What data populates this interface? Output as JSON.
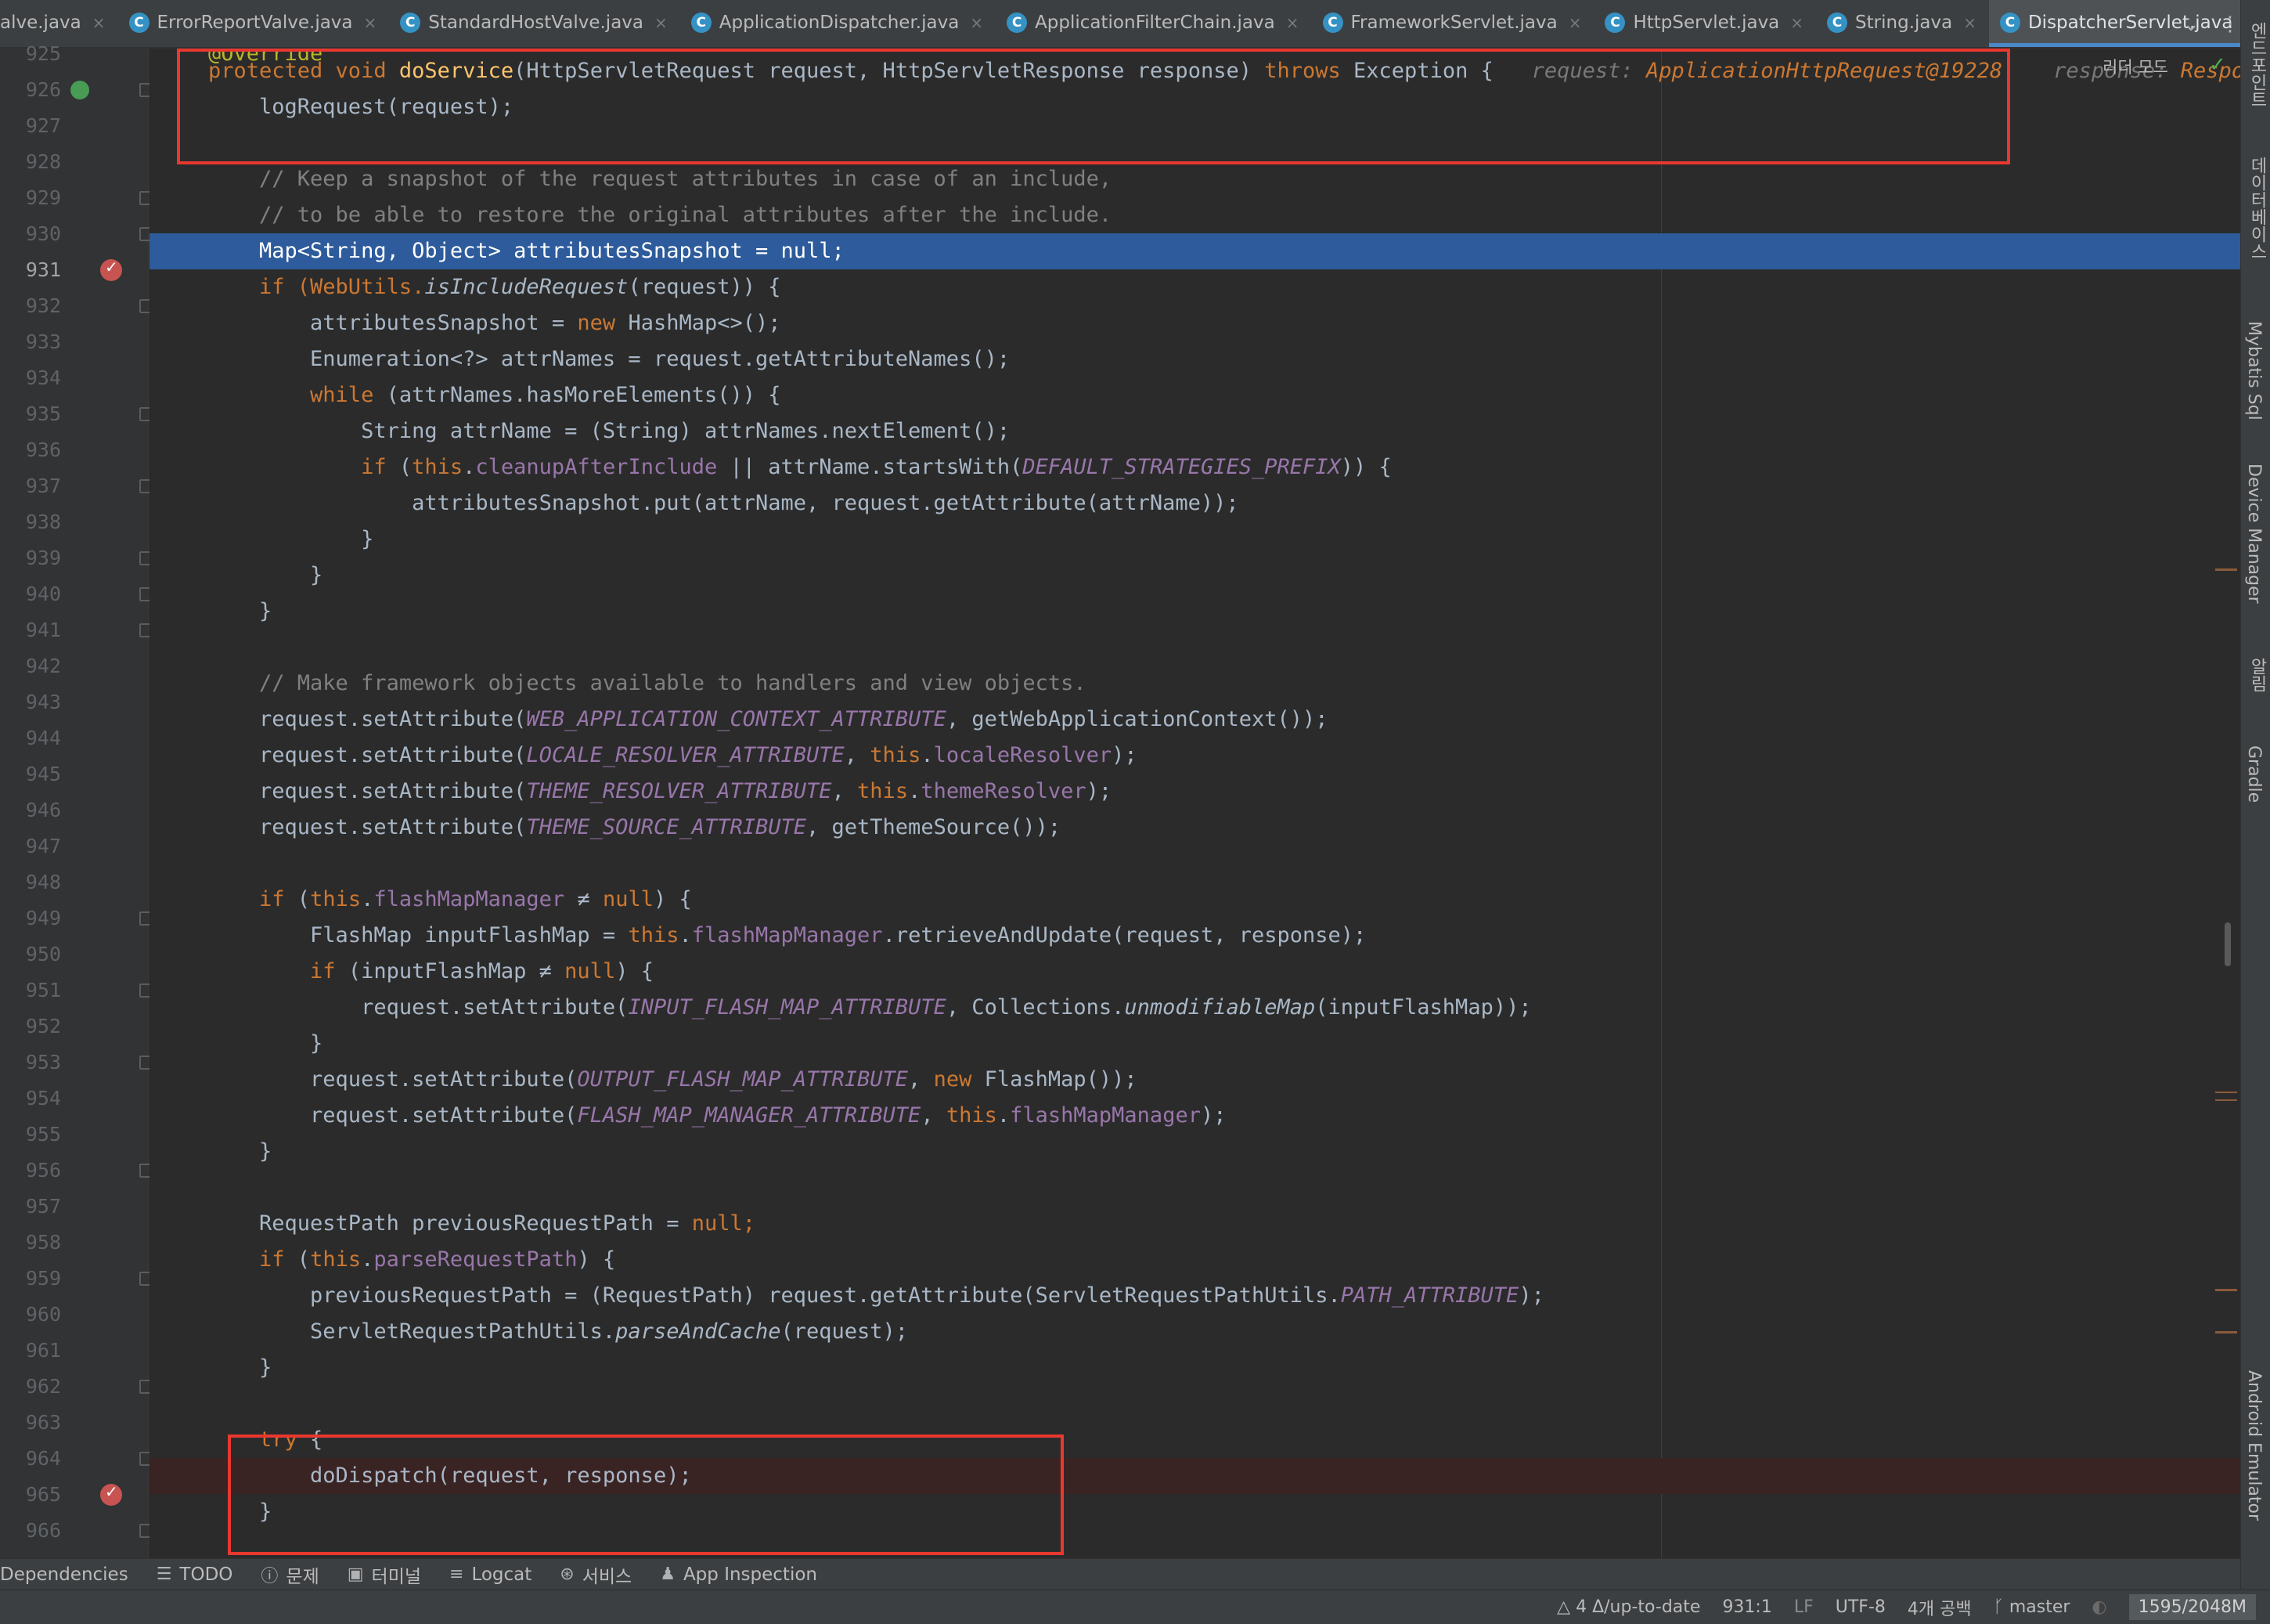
{
  "tabs": [
    {
      "label": "alve.java",
      "icon": "",
      "active": false
    },
    {
      "label": "ErrorReportValve.java",
      "icon": "C",
      "active": false
    },
    {
      "label": "StandardHostValve.java",
      "icon": "C",
      "active": false
    },
    {
      "label": "ApplicationDispatcher.java",
      "icon": "C",
      "active": false
    },
    {
      "label": "ApplicationFilterChain.java",
      "icon": "C",
      "active": false
    },
    {
      "label": "FrameworkServlet.java",
      "icon": "C",
      "active": false
    },
    {
      "label": "HttpServlet.java",
      "icon": "C",
      "active": false
    },
    {
      "label": "String.java",
      "icon": "C",
      "active": false
    },
    {
      "label": "DispatcherServlet.java",
      "icon": "C",
      "active": true
    }
  ],
  "tab_close_glyph": "×",
  "tab_tools": {
    "chevron": "⌄",
    "menu": "⋮"
  },
  "reader_mode": {
    "label": "리더 모드",
    "check": "✓"
  },
  "right_strip": [
    {
      "label": "엔드포인트"
    },
    {
      "label": "데이터베이스"
    },
    {
      "label": "Mybatis Sql"
    },
    {
      "label": "Device Manager"
    },
    {
      "label": "알림"
    },
    {
      "label": "Gradle"
    },
    {
      "label": "Android Emulator"
    }
  ],
  "gutter": {
    "lines": [
      "925",
      "926",
      "927",
      "928",
      "929",
      "930",
      "931",
      "932",
      "933",
      "934",
      "935",
      "936",
      "937",
      "938",
      "939",
      "940",
      "941",
      "942",
      "943",
      "944",
      "945",
      "946",
      "947",
      "948",
      "949",
      "950",
      "951",
      "952",
      "953",
      "954",
      "955",
      "956",
      "957",
      "958",
      "959",
      "960",
      "961",
      "962",
      "963",
      "964",
      "965",
      "966"
    ],
    "current_line": "931",
    "breakpoint_lines": [
      "931",
      "965"
    ],
    "override_marker_line": "926"
  },
  "code": {
    "l925": "@Override",
    "l926_kw": "protected void ",
    "l926_fn": "doService",
    "l926_sig": "(HttpServletRequest request, HttpServletResponse response) ",
    "l926_throws": "throws",
    "l926_exc": " Exception {",
    "l926_hint1_name": "request: ",
    "l926_hint1_val": "ApplicationHttpRequest@19228",
    "l926_hint2_name": "response: ",
    "l926_hint2_val": "Respons",
    "l927": "    logRequest(request);",
    "l929": "    // Keep a snapshot of the request attributes in case of an include,",
    "l930": "    // to be able to restore the original attributes after the include.",
    "l931": "    Map<String, Object> attributesSnapshot = null;",
    "l932_a": "    if (WebUtils.",
    "l932_b": "isIncludeRequest",
    "l932_c": "(request)) {",
    "l933_a": "        attributesSnapshot = ",
    "l933_b": "new",
    "l933_c": " HashMap<>();",
    "l934": "        Enumeration<?> attrNames = request.getAttributeNames();",
    "l935_a": "        while",
    "l935_b": " (attrNames.hasMoreElements()) {",
    "l936": "            String attrName = (String) attrNames.nextElement();",
    "l937_a": "            if",
    "l937_b": " (",
    "l937_c": "this",
    "l937_d": ".",
    "l937_e": "cleanupAfterInclude",
    "l937_f": " || attrName.startsWith(",
    "l937_g": "DEFAULT_STRATEGIES_PREFIX",
    "l937_h": ")) {",
    "l938": "                attributesSnapshot.put(attrName, request.getAttribute(attrName));",
    "l939": "            }",
    "l940": "        }",
    "l941": "    }",
    "l943": "    // Make framework objects available to handlers and view objects.",
    "l944_a": "    request.setAttribute(",
    "l944_b": "WEB_APPLICATION_CONTEXT_ATTRIBUTE",
    "l944_c": ", getWebApplicationContext());",
    "l945_a": "    request.setAttribute(",
    "l945_b": "LOCALE_RESOLVER_ATTRIBUTE",
    "l945_c": ", ",
    "l945_d": "this",
    "l945_e": ".",
    "l945_f": "localeResolver",
    "l945_g": ");",
    "l946_a": "    request.setAttribute(",
    "l946_b": "THEME_RESOLVER_ATTRIBUTE",
    "l946_c": ", ",
    "l946_d": "this",
    "l946_e": ".",
    "l946_f": "themeResolver",
    "l946_g": ");",
    "l947_a": "    request.setAttribute(",
    "l947_b": "THEME_SOURCE_ATTRIBUTE",
    "l947_c": ", getThemeSource());",
    "l949_a": "    if",
    "l949_b": " (",
    "l949_c": "this",
    "l949_d": ".",
    "l949_e": "flashMapManager",
    "l949_f": " ≠ ",
    "l949_g": "null",
    "l949_h": ") {",
    "l950_a": "        FlashMap inputFlashMap = ",
    "l950_b": "this",
    "l950_c": ".",
    "l950_d": "flashMapManager",
    "l950_e": ".retrieveAndUpdate(request, response);",
    "l951_a": "        if",
    "l951_b": " (inputFlashMap ≠ ",
    "l951_c": "null",
    "l951_d": ") {",
    "l952_a": "            request.setAttribute(",
    "l952_b": "INPUT_FLASH_MAP_ATTRIBUTE",
    "l952_c": ", Collections.",
    "l952_d": "unmodifiableMap",
    "l952_e": "(inputFlashMap));",
    "l953": "        }",
    "l954_a": "        request.setAttribute(",
    "l954_b": "OUTPUT_FLASH_MAP_ATTRIBUTE",
    "l954_c": ", ",
    "l954_d": "new",
    "l954_e": " FlashMap());",
    "l955_a": "        request.setAttribute(",
    "l955_b": "FLASH_MAP_MANAGER_ATTRIBUTE",
    "l955_c": ", ",
    "l955_d": "this",
    "l955_e": ".",
    "l955_f": "flashMapManager",
    "l955_g": ");",
    "l956": "    }",
    "l958_a": "    RequestPath previousRequestPath = ",
    "l958_b": "null",
    "l958_c": ";",
    "l959_a": "    if",
    "l959_b": " (",
    "l959_c": "this",
    "l959_d": ".",
    "l959_e": "parseRequestPath",
    "l959_f": ") {",
    "l960_a": "        previousRequestPath = (RequestPath) request.getAttribute(ServletRequestPathUtils.",
    "l960_b": "PATH_ATTRIBUTE",
    "l960_c": ");",
    "l961_a": "        ServletRequestPathUtils.",
    "l961_b": "parseAndCache",
    "l961_c": "(request);",
    "l962": "    }",
    "l964_a": "    try",
    "l964_b": " {",
    "l965": "        doDispatch(request, response);",
    "l966": "    }"
  },
  "tool_windows": [
    {
      "label": "Dependencies",
      "icon": "dependencies-icon",
      "glyph": ""
    },
    {
      "label": "TODO",
      "icon": "todo-icon",
      "glyph": "☰"
    },
    {
      "label": "문제",
      "icon": "problems-icon",
      "glyph": "ⓘ"
    },
    {
      "label": "터미널",
      "icon": "terminal-icon",
      "glyph": "▣"
    },
    {
      "label": "Logcat",
      "icon": "logcat-icon",
      "glyph": "≡"
    },
    {
      "label": "서비스",
      "icon": "services-icon",
      "glyph": "⊛"
    },
    {
      "label": "App Inspection",
      "icon": "app-inspection-icon",
      "glyph": "♟"
    }
  ],
  "status": {
    "vcs": "△ 4 Δ/up-to-date",
    "position": "931:1",
    "line_sep": "LF",
    "encoding": "UTF-8",
    "indent": "4개 공백",
    "branch_icon": "ᚴ",
    "branch": "master",
    "lock_icon": "◐",
    "memory": "1595/2048M"
  },
  "colors": {
    "background": "#2b2b2b",
    "keyword": "#cc7832",
    "annotation": "#bbb529",
    "comment": "#808080",
    "field": "#9876aa",
    "method": "#ffc66d",
    "execution_line": "#2d5b9b",
    "breakpoint": "#c75450",
    "highlight_box": "#e8382f"
  }
}
